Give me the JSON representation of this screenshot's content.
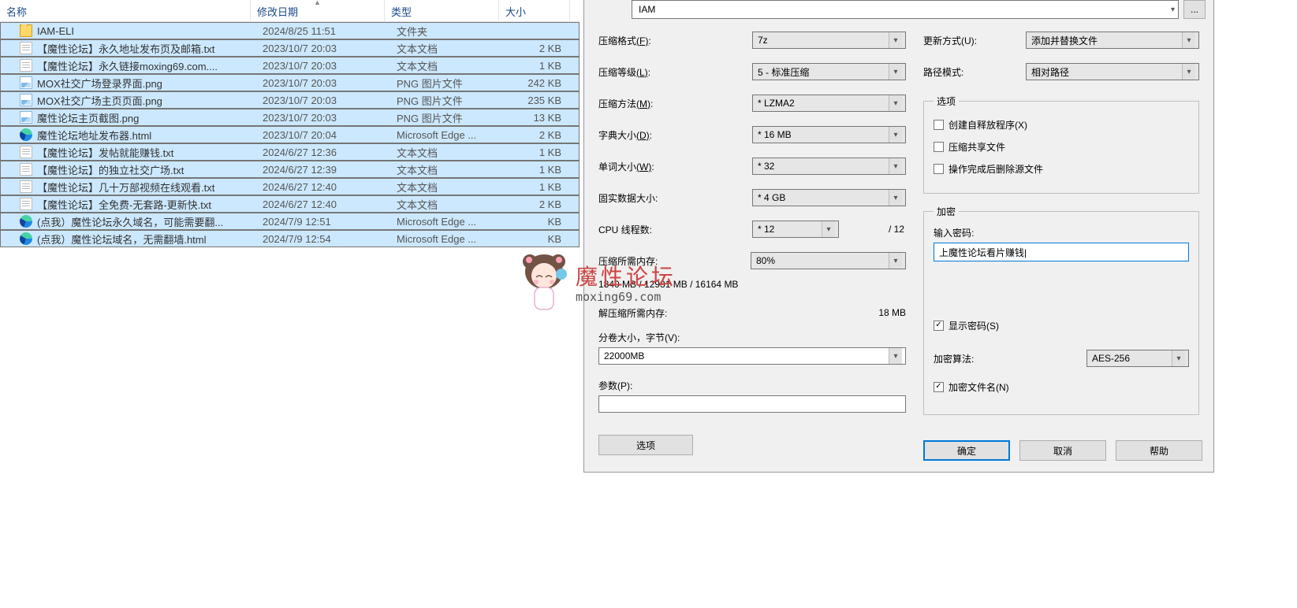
{
  "explorer": {
    "columns": {
      "name": "名称",
      "date": "修改日期",
      "type": "类型",
      "size": "大小"
    },
    "rows": [
      {
        "icon": "folder",
        "name": "IAM-ELI",
        "date": "2024/8/25 11:51",
        "type": "文件夹",
        "size": "",
        "sel": true
      },
      {
        "icon": "txt",
        "name": "【魔性论坛】永久地址发布页及邮箱.txt",
        "date": "2023/10/7 20:03",
        "type": "文本文档",
        "size": "2 KB",
        "sel": true
      },
      {
        "icon": "txt",
        "name": "【魔性论坛】永久链接moxing69.com....",
        "date": "2023/10/7 20:03",
        "type": "文本文档",
        "size": "1 KB",
        "sel": true
      },
      {
        "icon": "png",
        "name": "MOX社交广场登录界面.png",
        "date": "2023/10/7 20:03",
        "type": "PNG 图片文件",
        "size": "242 KB",
        "sel": true
      },
      {
        "icon": "png",
        "name": "MOX社交广场主页页面.png",
        "date": "2023/10/7 20:03",
        "type": "PNG 图片文件",
        "size": "235 KB",
        "sel": true
      },
      {
        "icon": "png",
        "name": "魔性论坛主页截图.png",
        "date": "2023/10/7 20:03",
        "type": "PNG 图片文件",
        "size": "13 KB",
        "sel": true
      },
      {
        "icon": "edge",
        "name": "魔性论坛地址发布器.html",
        "date": "2023/10/7 20:04",
        "type": "Microsoft Edge ...",
        "size": "2 KB",
        "sel": true
      },
      {
        "icon": "txt",
        "name": "【魔性论坛】发帖就能赚钱.txt",
        "date": "2024/6/27 12:36",
        "type": "文本文档",
        "size": "1 KB",
        "sel": true
      },
      {
        "icon": "txt",
        "name": "【魔性论坛】的独立社交广场.txt",
        "date": "2024/6/27 12:39",
        "type": "文本文档",
        "size": "1 KB",
        "sel": true
      },
      {
        "icon": "txt",
        "name": "【魔性论坛】几十万部视频在线观看.txt",
        "date": "2024/6/27 12:40",
        "type": "文本文档",
        "size": "1 KB",
        "sel": true
      },
      {
        "icon": "txt",
        "name": "【魔性论坛】全免费-无套路-更新快.txt",
        "date": "2024/6/27 12:40",
        "type": "文本文档",
        "size": "2 KB",
        "sel": true
      },
      {
        "icon": "edge",
        "name": "(点我）魔性论坛永久域名，可能需要翻...",
        "date": "2024/7/9 12:51",
        "type": "Microsoft Edge ...",
        "size": "KB",
        "sel": true
      },
      {
        "icon": "edge",
        "name": "(点我）魔性论坛域名，无需翻墙.html",
        "date": "2024/7/9 12:54",
        "type": "Microsoft Edge ...",
        "size": "KB",
        "sel": true
      }
    ]
  },
  "dialog": {
    "archive_name": "IAM",
    "browse": "...",
    "labels": {
      "format": "压缩格式",
      "format_k": "(F)",
      "format_v": "7z",
      "level": "压缩等级",
      "level_k": "(L)",
      "level_v": "5 - 标准压缩",
      "method": "压缩方法",
      "method_k": "(M)",
      "method_v": "* LZMA2",
      "dict": "字典大小",
      "dict_k": "(D)",
      "dict_v": "* 16 MB",
      "word": "单词大小",
      "word_k": "(W)",
      "word_v": "* 32",
      "solid": "固实数据大小",
      "solid_v": "* 4 GB",
      "threads": "CPU 线程数",
      "threads_v": "* 12",
      "threads_max": "/ 12",
      "mem_comp": "压缩所需内存",
      "mem_comp_v": "1840 MB / 12931 MB / 16164 MB",
      "mem_pct": "80%",
      "mem_decomp": "解压缩所需内存",
      "mem_decomp_v": "18 MB",
      "vol": "分卷大小，字节",
      "vol_k": "(V)",
      "vol_v": "22000MB",
      "param": "参数",
      "param_k": "(P)",
      "param_v": "",
      "options_btn": "选项",
      "update": "更新方式",
      "update_k": "(U)",
      "update_v": "添加并替换文件",
      "pathmode": "路径模式",
      "pathmode_v": "相对路径",
      "opts_group": "选项",
      "sfx": "创建自释放程序",
      "sfx_k": "(X)",
      "shared": "压缩共享文件",
      "delafter": "操作完成后删除源文件",
      "enc_group": "加密",
      "pwd": "输入密码:",
      "pwd_v": "上魔性论坛看片赚钱|",
      "showpwd": "显示密码",
      "showpwd_k": "(S)",
      "encmethod": "加密算法",
      "encmethod_v": "AES-256",
      "encnames": "加密文件名",
      "encnames_k": "(N)"
    },
    "buttons": {
      "ok": "确定",
      "cancel": "取消",
      "help": "帮助"
    }
  },
  "watermark": {
    "text": "魔性论坛",
    "url": "moxing69.com"
  }
}
